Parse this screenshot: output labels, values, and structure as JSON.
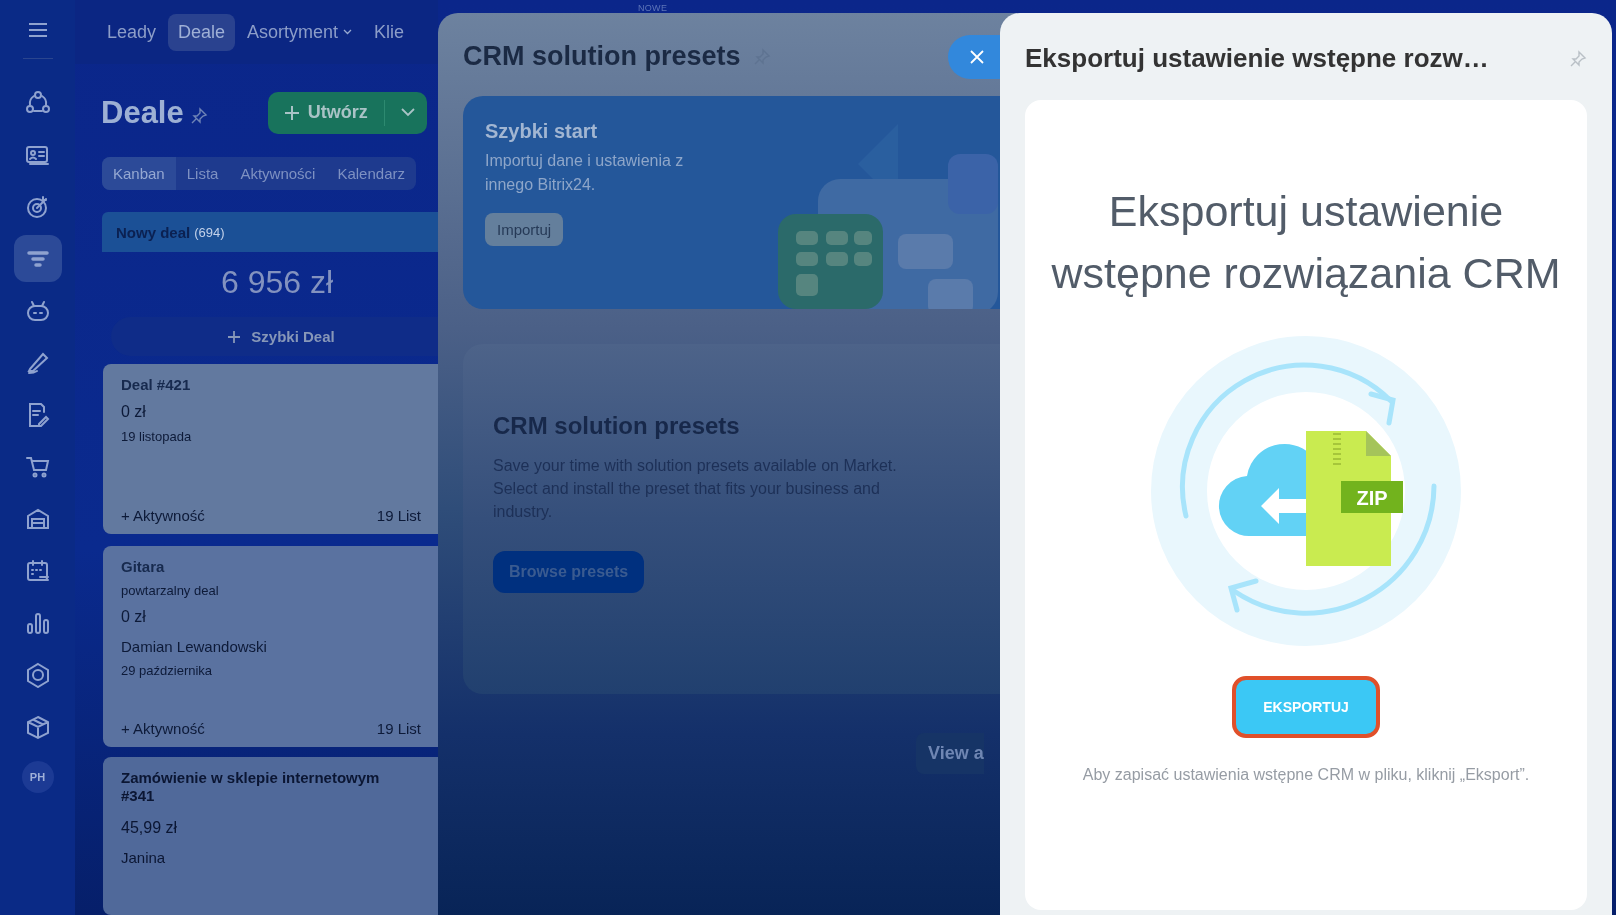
{
  "sidebar": {
    "items": [
      {
        "kind": "flow",
        "selected": false
      },
      {
        "kind": "card",
        "selected": false
      },
      {
        "kind": "target",
        "selected": false
      },
      {
        "kind": "funnel",
        "selected": true
      },
      {
        "kind": "robot",
        "selected": false
      },
      {
        "kind": "pen",
        "selected": false
      },
      {
        "kind": "document",
        "selected": false
      },
      {
        "kind": "cart",
        "selected": false
      },
      {
        "kind": "warehouse",
        "selected": false
      },
      {
        "kind": "calendar",
        "selected": false
      },
      {
        "kind": "chart",
        "selected": false
      },
      {
        "kind": "hexagon",
        "selected": false
      },
      {
        "kind": "box",
        "selected": false
      }
    ],
    "avatar": "PH"
  },
  "top_nav": [
    {
      "label": "Leady",
      "selected": false,
      "dropdown": false
    },
    {
      "label": "Deale",
      "selected": true,
      "dropdown": false
    },
    {
      "label": "Asortyment",
      "selected": false,
      "dropdown": true
    },
    {
      "label": "Klie",
      "selected": false,
      "dropdown": false
    }
  ],
  "badge": "NOWE",
  "page": {
    "title": "Deale",
    "create_button": "Utwórz",
    "view_tabs": [
      {
        "label": "Kanban",
        "selected": true
      },
      {
        "label": "Lista",
        "selected": false
      },
      {
        "label": "Aktywności",
        "selected": false
      },
      {
        "label": "Kalendarz",
        "selected": false
      }
    ],
    "column": {
      "title": "Nowy deal",
      "count": "(694)",
      "total": "6 956 zł",
      "quick_add": "Szybki Deal",
      "cards": [
        {
          "title": "Deal #421",
          "amount": "0 zł",
          "date": "19 listopada",
          "activity": "+ Aktywność",
          "time": "19 List"
        },
        {
          "title": "Gitara",
          "subtitle": "powtarzalny deal",
          "amount": "0 zł",
          "contact": "Damian Lewandowski",
          "date": "29 października",
          "activity": "+ Aktywność",
          "time": "19 List"
        },
        {
          "title": "Zamówienie w sklepie internetowym #341",
          "amount": "45,99 zł",
          "contact": "Janina"
        }
      ]
    }
  },
  "presets_panel": {
    "title": "CRM solution presets",
    "quick_start": {
      "title": "Szybki start",
      "text": "Importuj dane i ustawienia z innego Bitrix24.",
      "button": "Importuj"
    },
    "market": {
      "title": "CRM solution presets",
      "text": "Save your time with solution presets available on Market. Select and install the preset that fits your business and industry.",
      "button": "Browse presets"
    },
    "view_all": "View a"
  },
  "export_panel": {
    "title": "Eksportuj ustawienie wstępne rozw…",
    "heading": "Eksportuj ustawienie wstępne rozwiązania CRM",
    "zip_label": "ZIP",
    "button": "EKSPORTUJ",
    "hint": "Aby zapisać ustawienia wstępne CRM w pliku, kliknij „Eksport”."
  }
}
